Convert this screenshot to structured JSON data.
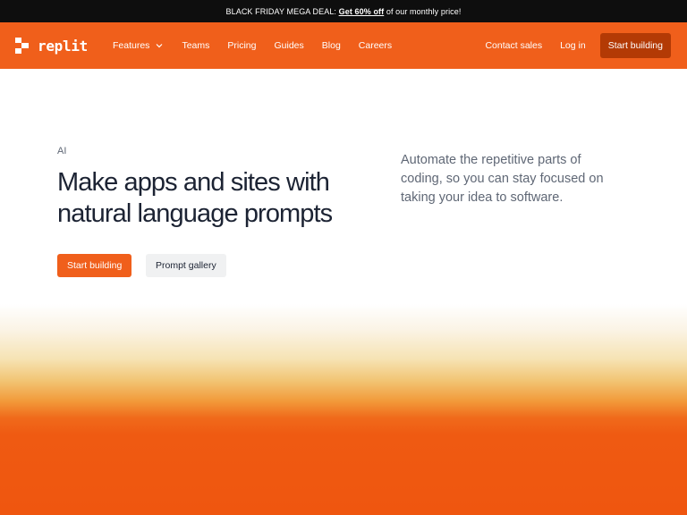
{
  "promo": {
    "prefix": "BLACK FRIDAY MEGA DEAL: ",
    "link": "Get 60% off",
    "suffix": " of our monthly price!"
  },
  "nav": {
    "logo_text": "replit",
    "links": [
      "Features",
      "Teams",
      "Pricing",
      "Guides",
      "Blog",
      "Careers"
    ],
    "contact": "Contact sales",
    "login": "Log in",
    "cta": "Start building"
  },
  "hero": {
    "eyebrow": "AI",
    "headline": "Make apps and sites with natural language prompts",
    "primary_button": "Start building",
    "secondary_button": "Prompt gallery",
    "description": "Automate the repetitive parts of coding, so you can stay focused on taking your idea to software."
  },
  "colors": {
    "brand_orange": "#f05f1b",
    "cta_dark_orange": "#b33a05",
    "promo_bar": "#0e0e0e",
    "headline_text": "#1c2333"
  }
}
